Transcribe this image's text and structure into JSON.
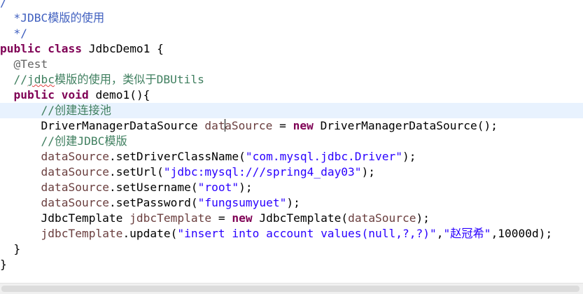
{
  "editor": {
    "caret_line": 7,
    "lines": [
      [
        {
          "t": "/",
          "c": "javadoc"
        }
      ],
      [
        {
          "t": "  *JDBC模版的使用",
          "c": "javadoc"
        }
      ],
      [
        {
          "t": "  */",
          "c": "javadoc"
        }
      ],
      [
        {
          "t": "public",
          "c": "kw"
        },
        {
          "t": " ",
          "c": "plain"
        },
        {
          "t": "class",
          "c": "kw"
        },
        {
          "t": " JdbcDemo1 {",
          "c": "plain"
        }
      ],
      [
        {
          "t": "  ",
          "c": "plain"
        },
        {
          "t": "@Test",
          "c": "ann"
        }
      ],
      [
        {
          "t": "  //",
          "c": "comment"
        },
        {
          "t": "jdbc",
          "c": "comment",
          "spell": true
        },
        {
          "t": "模版的使用，类似于DBUtils",
          "c": "comment"
        }
      ],
      [
        {
          "t": "  ",
          "c": "plain"
        },
        {
          "t": "public",
          "c": "kw"
        },
        {
          "t": " ",
          "c": "plain"
        },
        {
          "t": "void",
          "c": "kw"
        },
        {
          "t": " demo1(){",
          "c": "plain"
        }
      ],
      [
        {
          "t": "      //创建连接池",
          "c": "comment"
        }
      ],
      [
        {
          "t": "      DriverManagerDataSource ",
          "c": "plain"
        },
        {
          "t": "dataSource",
          "c": "field",
          "caret": 3
        },
        {
          "t": " = ",
          "c": "plain"
        },
        {
          "t": "new",
          "c": "kw"
        },
        {
          "t": " DriverManagerDataSource();",
          "c": "plain"
        }
      ],
      [
        {
          "t": "      //创建JDBC模版",
          "c": "comment"
        }
      ],
      [
        {
          "t": "      ",
          "c": "plain"
        },
        {
          "t": "dataSource",
          "c": "field"
        },
        {
          "t": ".setDriverClassName(",
          "c": "plain"
        },
        {
          "t": "\"com.mysql.jdbc.Driver\"",
          "c": "str"
        },
        {
          "t": ");",
          "c": "plain"
        }
      ],
      [
        {
          "t": "      ",
          "c": "plain"
        },
        {
          "t": "dataSource",
          "c": "field"
        },
        {
          "t": ".setUrl(",
          "c": "plain"
        },
        {
          "t": "\"jdbc:mysql:///spring4_day03\"",
          "c": "str"
        },
        {
          "t": ");",
          "c": "plain"
        }
      ],
      [
        {
          "t": "      ",
          "c": "plain"
        },
        {
          "t": "dataSource",
          "c": "field"
        },
        {
          "t": ".setUsername(",
          "c": "plain"
        },
        {
          "t": "\"root\"",
          "c": "str"
        },
        {
          "t": ");",
          "c": "plain"
        }
      ],
      [
        {
          "t": "      ",
          "c": "plain"
        },
        {
          "t": "dataSource",
          "c": "field"
        },
        {
          "t": ".setPassword(",
          "c": "plain"
        },
        {
          "t": "\"fungsumyuet\"",
          "c": "str"
        },
        {
          "t": ");",
          "c": "plain"
        }
      ],
      [
        {
          "t": "      JdbcTemplate ",
          "c": "plain"
        },
        {
          "t": "jdbcTemplate",
          "c": "field"
        },
        {
          "t": " = ",
          "c": "plain"
        },
        {
          "t": "new",
          "c": "kw"
        },
        {
          "t": " JdbcTemplate(",
          "c": "plain"
        },
        {
          "t": "dataSource",
          "c": "field"
        },
        {
          "t": ");",
          "c": "plain"
        }
      ],
      [
        {
          "t": "      ",
          "c": "plain"
        },
        {
          "t": "jdbcTemplate",
          "c": "field"
        },
        {
          "t": ".update(",
          "c": "plain"
        },
        {
          "t": "\"insert into account values(null,?,?)\"",
          "c": "str"
        },
        {
          "t": ",",
          "c": "plain"
        },
        {
          "t": "\"赵冠希\"",
          "c": "str"
        },
        {
          "t": ",10000d);",
          "c": "plain"
        }
      ],
      [
        {
          "t": "  }",
          "c": "plain"
        }
      ],
      [
        {
          "t": "}",
          "c": "plain"
        }
      ]
    ]
  }
}
